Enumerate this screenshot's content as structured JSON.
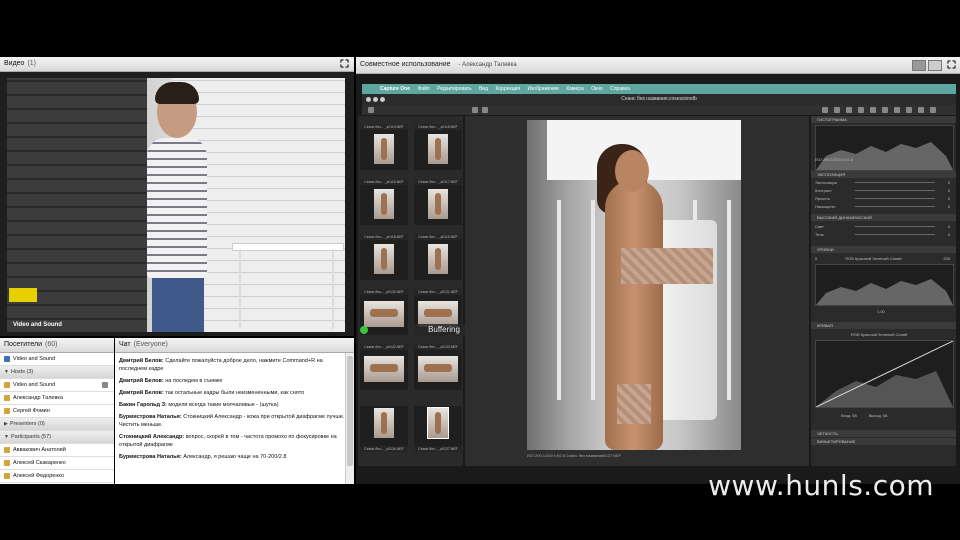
{
  "video_panel": {
    "title": "Видео",
    "count": "(1)",
    "label": "Video and Sound"
  },
  "visitors": {
    "title": "Посетители",
    "count": "(60)",
    "rows": [
      {
        "kind": "item",
        "label": "Video and Sound"
      },
      {
        "kind": "group",
        "label": "Hosts (3)"
      },
      {
        "kind": "item",
        "label": "Video and Sound"
      },
      {
        "kind": "item",
        "label": "Александр Талевка"
      },
      {
        "kind": "item",
        "label": "Сергей Фомин"
      },
      {
        "kind": "group",
        "label": "Presenters (0)"
      },
      {
        "kind": "group",
        "label": "Participants (57)"
      },
      {
        "kind": "item",
        "label": "Аввакович Анатолий"
      },
      {
        "kind": "item",
        "label": "Алексей Скакаренко"
      },
      {
        "kind": "item",
        "label": "Алексей Федоренко"
      }
    ]
  },
  "chat": {
    "title": "Чат",
    "scope": "(Everyone)",
    "messages": [
      {
        "author": "Дмитрий Белов:",
        "text": "Сделайте пожалуйста доброе дело, нажмите Command+R на последнем кадре"
      },
      {
        "author": "Дмитрий Белов:",
        "text": "на последем в съемке"
      },
      {
        "author": "Дмитрий Белов:",
        "text": "так остальные кадры были неизмененными, как снято"
      },
      {
        "author": "Бакин Гарольд З:",
        "text": "модели всегда такие молчаливые - (шутка)"
      },
      {
        "author": "Бурмистрова Наталья:",
        "text": "Стокницкий Александр - кожа при открытой диафрагме лучше. Чистить меньше."
      },
      {
        "author": "Стокницкий Александр:",
        "text": "вопрос, скорей в том - частота промохо по фокусировке на открытой диафрагме"
      },
      {
        "author": "Бурмистрова Наталья:",
        "text": "Александр, я решаю чаще на 70-200/2.8"
      }
    ]
  },
  "share": {
    "title": "Совместное использование",
    "subtitle": "- Александр Талевка",
    "menubar": [
      "Capture One",
      "Файл",
      "Редактировать",
      "Вид",
      "Коррекция",
      "Изображение",
      "Камера",
      "Окно",
      "Справка"
    ],
    "app_title": "Сеанс без названия.cosessiondb",
    "thumb_captions": [
      "Сеанс без... _к0114.NEF",
      "Сеанс без... _к0115.NEF",
      "Сеанс без... _к0116.NEF",
      "Сеанс без... _к0117.NEF",
      "Сеанс без... _к0118.NEF",
      "Сеанс без... _к0119.NEF",
      "Сеанс без... _к0120.NEF",
      "Сеанс без... _к0121.NEF",
      "Сеанс без... _к0122.NEF",
      "Сеанс без... _к0123.NEF",
      "Сеанс без... _к0126.NEF",
      "Сеанс без... _к0127.NEF"
    ],
    "buffering": "Buffering",
    "viewer_status": "ISO 200    1/200 s    f/2.8    Сеанс без названия0127.NEF",
    "tools": {
      "histogram": "ГИСТОГРАММА",
      "histo_info": "ISO 200    1/200 s    f/2.8",
      "exposure": "ЭКСПОЗИЦИЯ",
      "exposure_rows": [
        "Экспозиция",
        "Контраст",
        "Яркость",
        "Насыщенн."
      ],
      "hdr": "ВЫСОКИЙ ДИНАМИЧЕСКИЙ",
      "hdr_rows": [
        "Свет",
        "Тень"
      ],
      "levels": "УРОВНИ",
      "levels_label": "RGB  Красный Зеленый Синий",
      "levels_min": "0",
      "levels_max": "255",
      "levels_mid": "1,00",
      "curve": "КРИВАЯ",
      "curve_label": "RGB  Красный Зеленый Синий",
      "curve_in": "Вход: 58",
      "curve_out": "Выход: 58",
      "sharpness": "ЧЕТКОСТЬ",
      "vignetting": "ВИНЬЕТИРОВАНИЕ",
      "zero": "0"
    }
  },
  "watermark": "www.hunls.com"
}
